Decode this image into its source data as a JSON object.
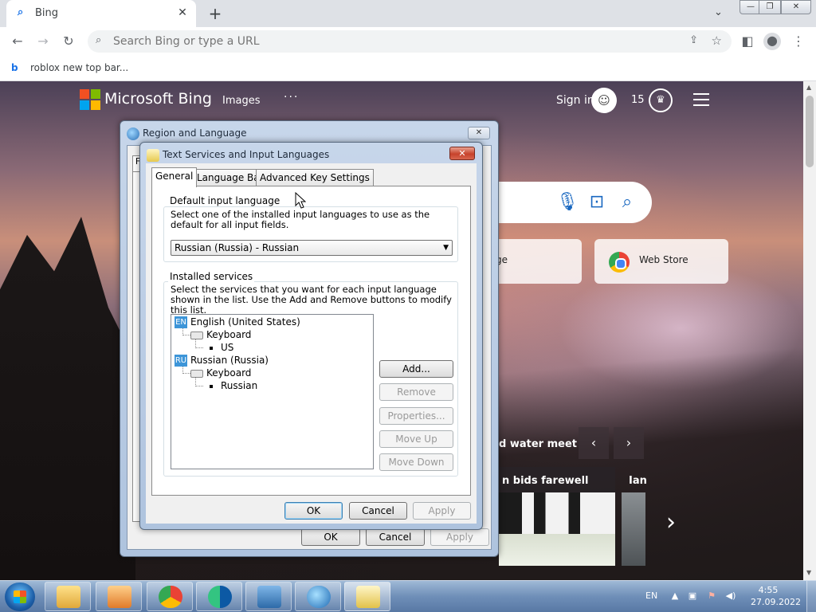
{
  "browser": {
    "tab_title": "Bing",
    "tab_close": "✕",
    "new_tab": "+",
    "tab_menu": "⌄",
    "omnibox_placeholder": "Search Bing or type a URL",
    "bookmark": "roblox new top bar..."
  },
  "bing": {
    "brand": "Microsoft Bing",
    "nav_images": "Images",
    "nav_more": "···",
    "sign_in": "Sign in",
    "points": "15",
    "tile_partial": "ge",
    "tile_web_store": "Web Store",
    "caption1": "d water meet",
    "caption2": "n bids farewell",
    "caption3": "Ian",
    "prev": "‹",
    "next": "›",
    "news_next": "›"
  },
  "region_dialog": {
    "title": "Region and Language",
    "close": "✕",
    "ok": "OK",
    "cancel": "Cancel",
    "apply": "Apply",
    "tab_stub": "F"
  },
  "text_services": {
    "title": "Text Services and Input Languages",
    "close": "✕",
    "tabs": [
      "General",
      "Language Bar",
      "Advanced Key Settings"
    ],
    "default_group_label": "Default input language",
    "default_desc": "Select one of the installed input languages to use as the default for all input fields.",
    "default_value": "Russian (Russia) - Russian",
    "services_group_label": "Installed services",
    "services_desc": "Select the services that you want for each input language shown in the list. Use the Add and Remove buttons to modify this list.",
    "tree": [
      {
        "badge": "EN",
        "label": "English (United States)"
      },
      {
        "label": "Keyboard"
      },
      {
        "label": "US"
      },
      {
        "badge": "RU",
        "label": "Russian (Russia)"
      },
      {
        "label": "Keyboard"
      },
      {
        "label": "Russian"
      }
    ],
    "buttons": {
      "add": "Add...",
      "remove": "Remove",
      "properties": "Properties...",
      "move_up": "Move Up",
      "move_down": "Move Down",
      "ok": "OK",
      "cancel": "Cancel",
      "apply": "Apply"
    }
  },
  "taskbar": {
    "lang": "EN",
    "time": "4:55",
    "date": "27.09.2022"
  },
  "colors": {
    "accent": "#1a73e8",
    "win_title": "#c7d6ea",
    "taskbar": "#6f8fb8"
  }
}
